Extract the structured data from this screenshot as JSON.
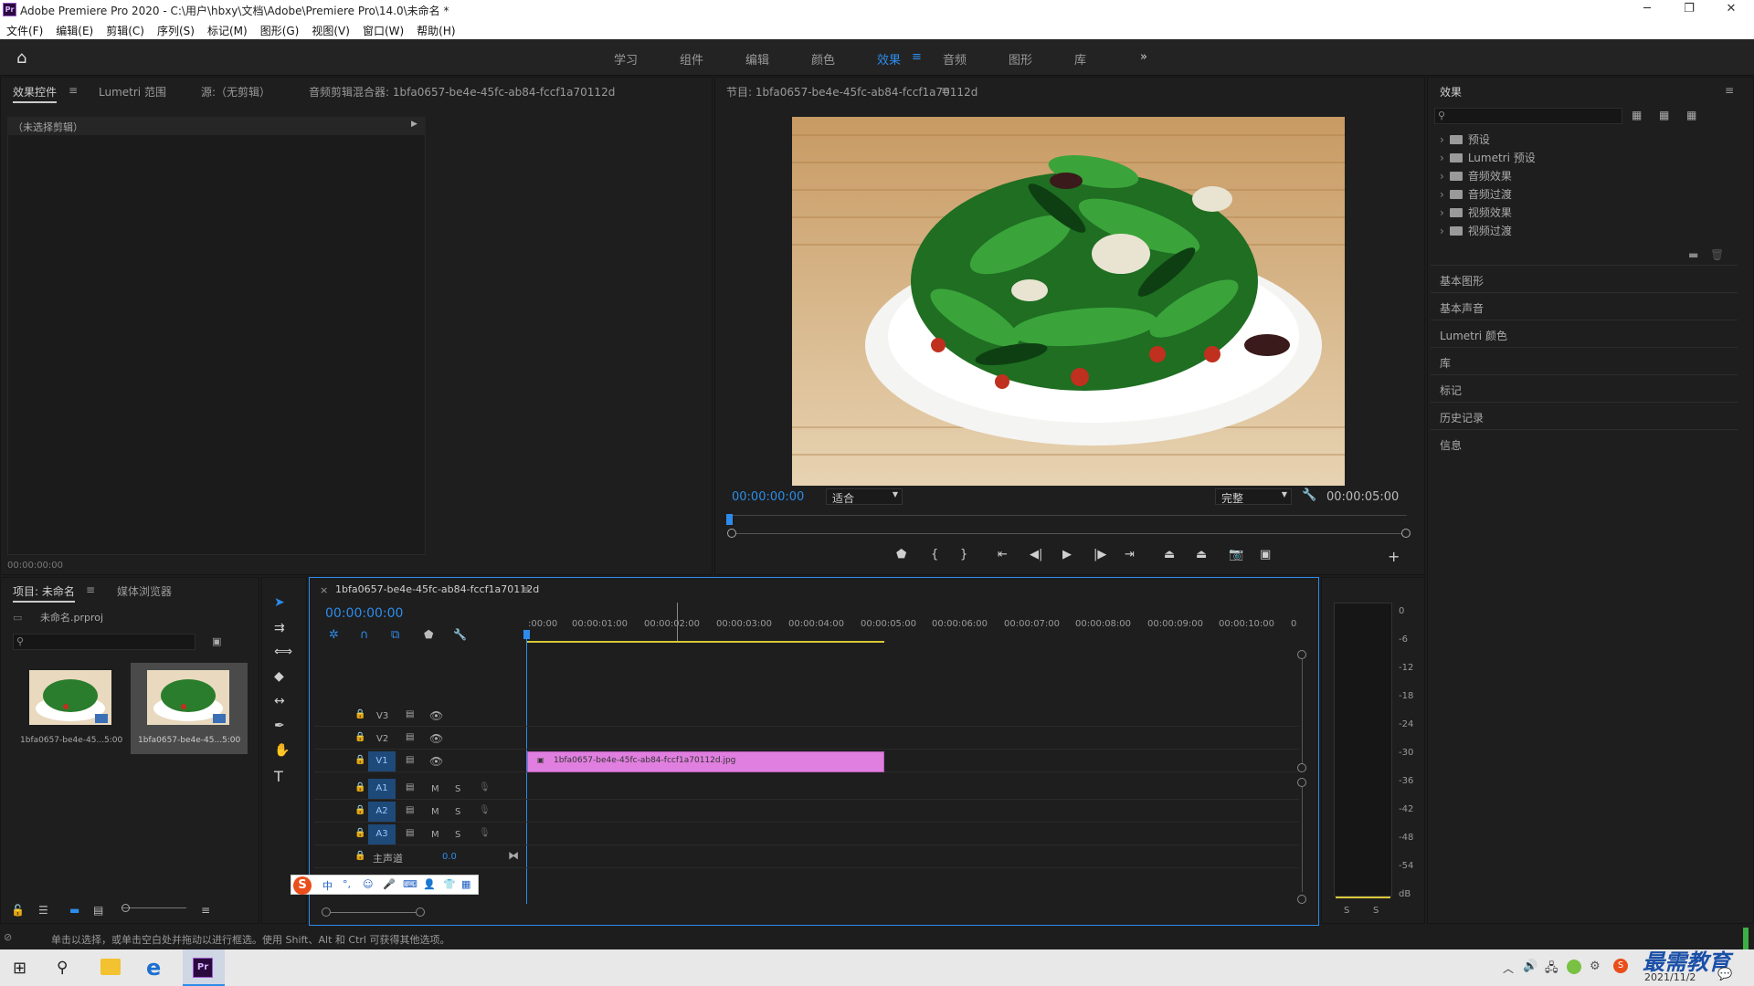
{
  "window": {
    "title": "Adobe Premiere Pro 2020 - C:\\用户\\hbxy\\文档\\Adobe\\Premiere Pro\\14.0\\未命名 *",
    "logo": "Pr"
  },
  "menu": [
    "文件(F)",
    "编辑(E)",
    "剪辑(C)",
    "序列(S)",
    "标记(M)",
    "图形(G)",
    "视图(V)",
    "窗口(W)",
    "帮助(H)"
  ],
  "workspaces": {
    "items": [
      "学习",
      "组件",
      "编辑",
      "颜色",
      "效果",
      "音频",
      "图形",
      "库"
    ],
    "active": "效果",
    "more": "»"
  },
  "source_panel": {
    "tabs": [
      "效果控件",
      "Lumetri 范围",
      "源:（无剪辑）",
      "音频剪辑混合器: 1bfa0657-be4e-45fc-ab84-fccf1a70112d"
    ],
    "no_clip": "（未选择剪辑）",
    "timecode": "00:00:00:00"
  },
  "program": {
    "title": "节目: 1bfa0657-be4e-45fc-ab84-fccf1a70112d",
    "timecode": "00:00:00:00",
    "fit": "适合",
    "quality": "完整",
    "duration": "00:00:05:00"
  },
  "effects": {
    "title": "效果",
    "folders": [
      "预设",
      "Lumetri 预设",
      "音频效果",
      "音频过渡",
      "视频效果",
      "视频过渡"
    ],
    "panels": [
      "基本图形",
      "基本声音",
      "Lumetri 颜色",
      "库",
      "标记",
      "历史记录",
      "信息"
    ]
  },
  "project": {
    "tabs": [
      "项目: 未命名",
      "媒体浏览器"
    ],
    "file": "未命名.prproj",
    "items": [
      {
        "name": "1bfa0657-be4e-45...",
        "dur": "5:00"
      },
      {
        "name": "1bfa0657-be4e-45...",
        "dur": "5:00"
      }
    ]
  },
  "timeline": {
    "tab": "1bfa0657-be4e-45fc-ab84-fccf1a70112d",
    "timecode": "00:00:00:00",
    "ruler": [
      ":00:00",
      "00:00:01:00",
      "00:00:02:00",
      "00:00:03:00",
      "00:00:04:00",
      "00:00:05:00",
      "00:00:06:00",
      "00:00:07:00",
      "00:00:08:00",
      "00:00:09:00",
      "00:00:10:00",
      "0"
    ],
    "video_tracks": [
      "V3",
      "V2",
      "V1"
    ],
    "audio_tracks": [
      "A1",
      "A2",
      "A3"
    ],
    "master": {
      "label": "主声道",
      "value": "0.0"
    },
    "clip": "1bfa0657-be4e-45fc-ab84-fccf1a70112d.jpg",
    "ms": [
      "M",
      "S"
    ]
  },
  "meter": {
    "scale": [
      "0",
      "-6",
      "-12",
      "-18",
      "-24",
      "-30",
      "-36",
      "-42",
      "-48",
      "-54",
      "dB"
    ],
    "solo": [
      "S",
      "S"
    ]
  },
  "status": "单击以选择，或单击空白处并拖动以进行框选。使用 Shift、Alt 和 Ctrl 可获得其他选项。",
  "taskbar": {
    "date": "2021/11/2",
    "watermark": "最需教育"
  },
  "colors": {
    "accent": "#2d8ceb",
    "clip": "#e07fdf",
    "timecode": "#2d8ceb"
  }
}
